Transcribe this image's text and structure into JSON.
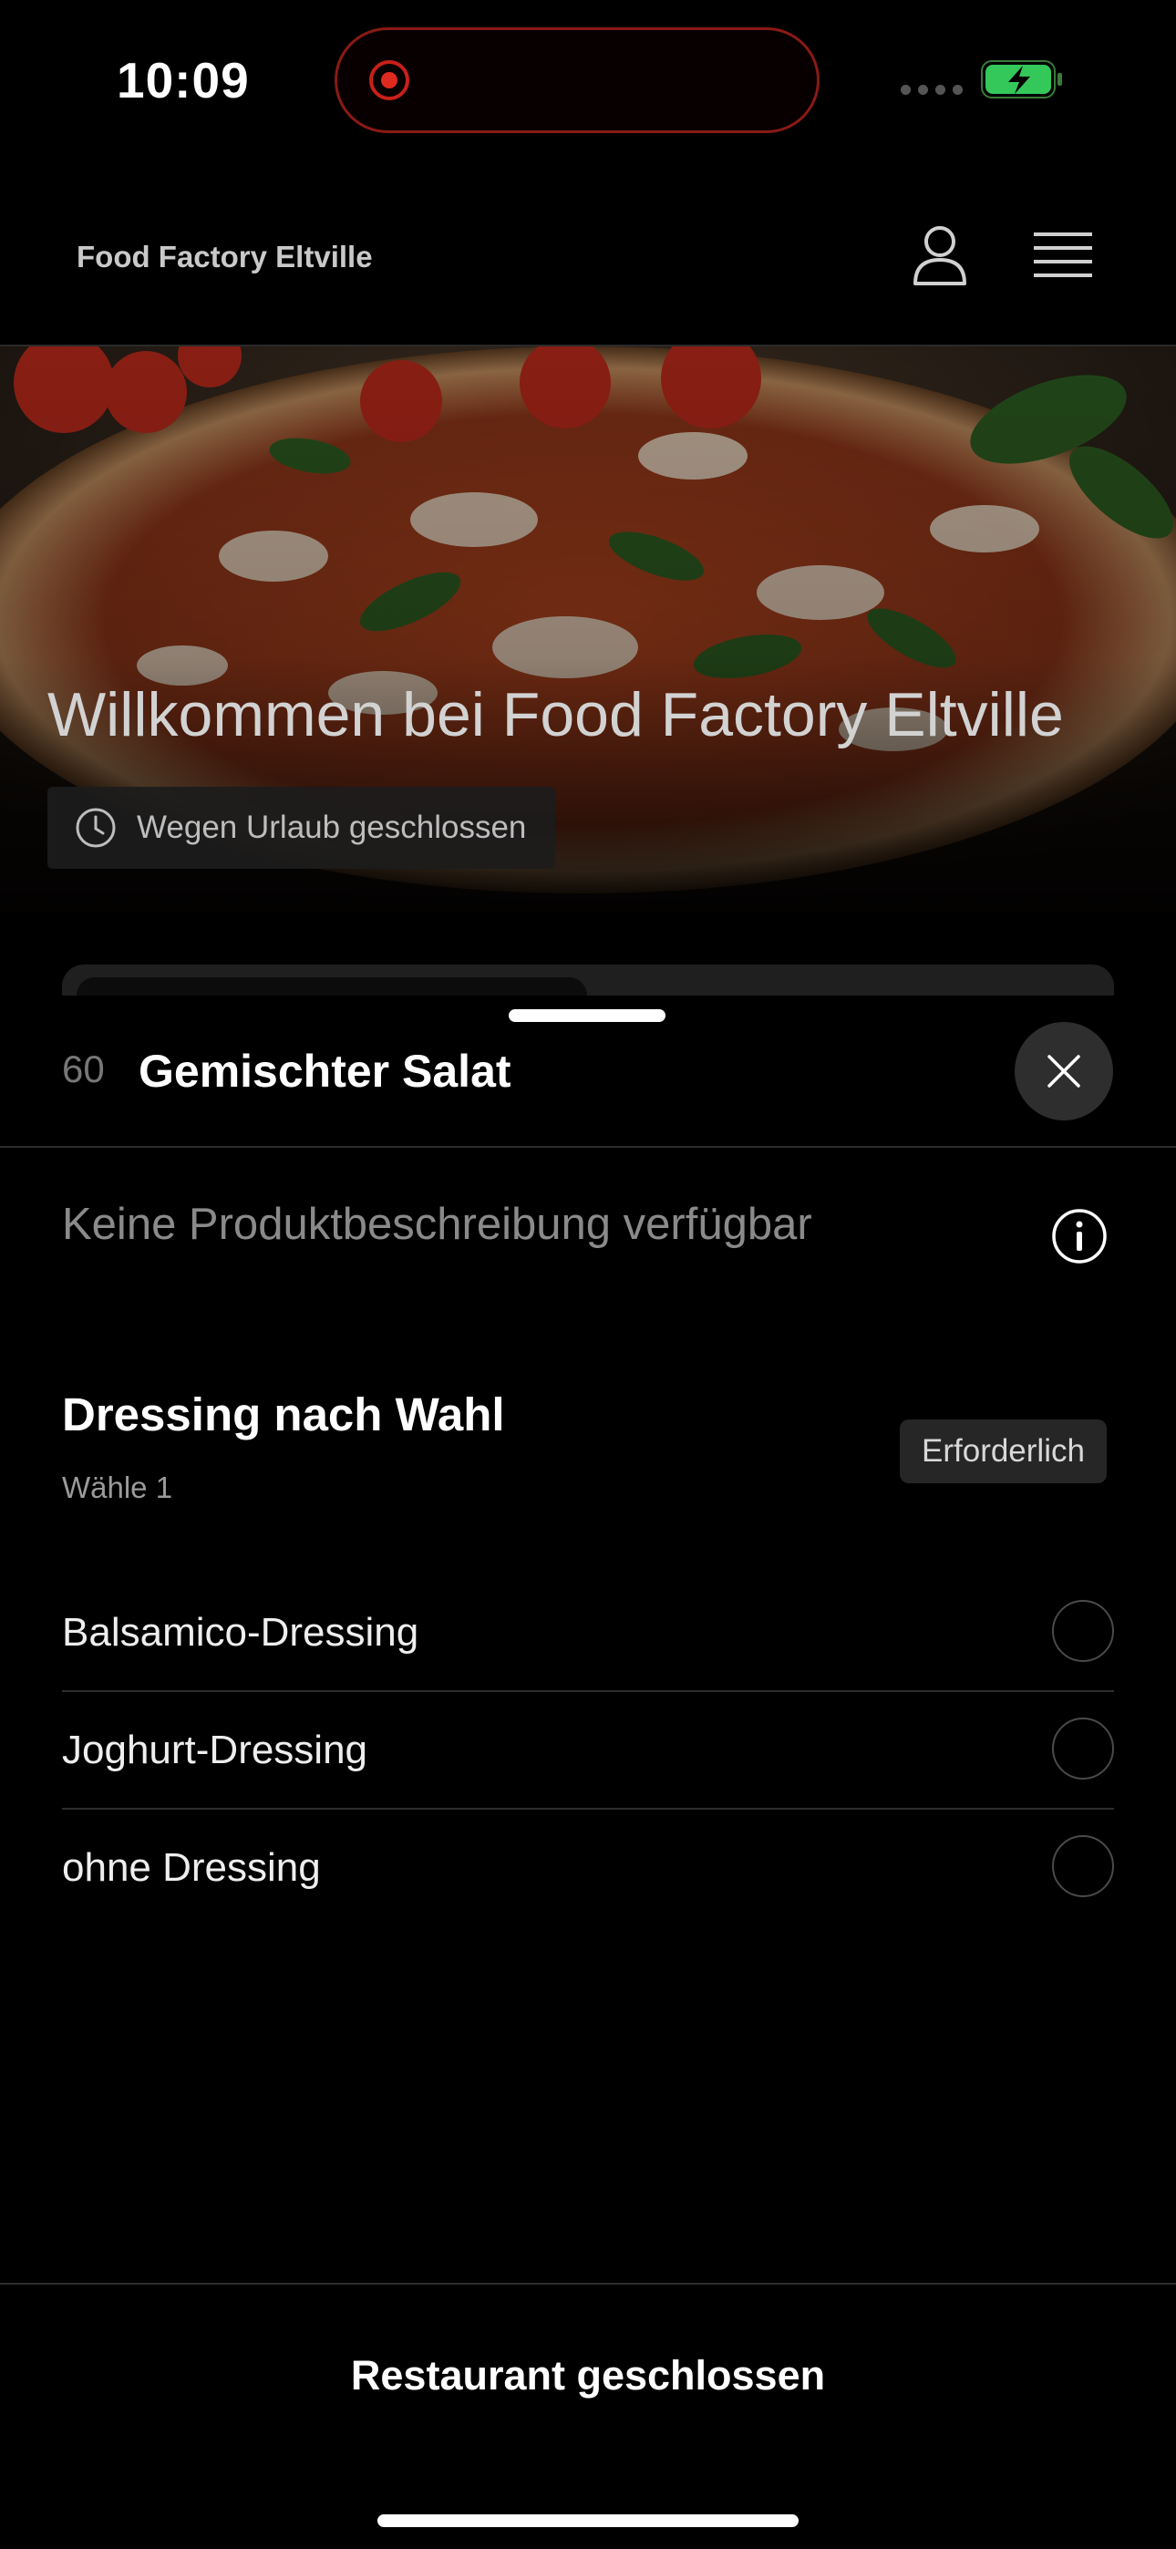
{
  "status_bar": {
    "time": "10:09",
    "recording_icon": "screen-recording-icon",
    "signal_icon": "cellular-signal-icon",
    "battery_icon": "battery-charging-icon",
    "battery_color": "#34c759"
  },
  "header": {
    "brand": "Food Factory Eltville",
    "account_icon": "user-icon",
    "menu_icon": "hamburger-menu-icon"
  },
  "hero": {
    "image": "pizza-photo",
    "title": "Willkommen bei Food Factory Eltville",
    "status_icon": "clock-icon",
    "status_text": "Wegen Urlaub geschlossen"
  },
  "product_sheet": {
    "number": "60",
    "name": "Gemischter Salat",
    "close_icon": "close-icon",
    "description": "Keine Produktbeschreibung verfügbar",
    "info_icon": "info-icon",
    "option_group": {
      "title": "Dressing nach Wahl",
      "subtitle": "Wähle 1",
      "badge": "Erforderlich",
      "options": [
        {
          "label": "Balsamico-Dressing"
        },
        {
          "label": "Joghurt-Dressing"
        },
        {
          "label": "ohne Dressing"
        }
      ]
    },
    "footer_button": "Restaurant geschlossen"
  }
}
